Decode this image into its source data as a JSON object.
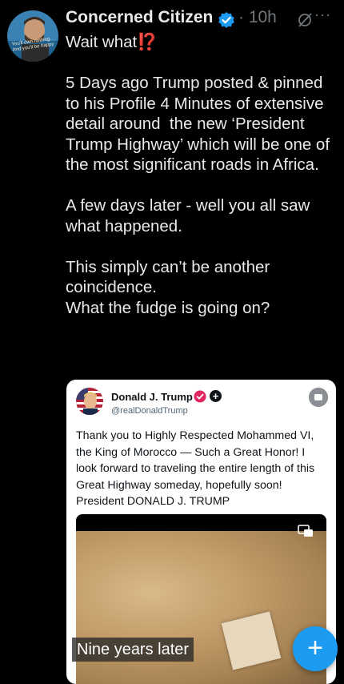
{
  "post": {
    "author": "Concerned Citizen",
    "time": "· 10h",
    "more": "···",
    "avatar_caption": "You'll own nothing. And you'll be happy",
    "text": "Wait what⁉️\n\n5 Days ago Trump posted & pinned to his Profile 4 Minutes of extensive detail around  the new ‘President Trump Highway’ which will be one of the most significant roads in Africa.\n\nA few days later - well you all saw what happened.\n\nThis simply can’t be another coincidence.\nWhat the fudge is going on?"
  },
  "quoted": {
    "name": "Donald J. Trump",
    "handle": "@realDonaldTrump",
    "plus": "+",
    "text": "Thank you to Highly Respected Mohammed VI, the King of Morocco — Such a Great Honor! I look forward to traveling the entire length of this Great Highway someday, hopefully soon! President DONALD J. TRUMP"
  },
  "media": {
    "caption": "Nine years later"
  },
  "fab": {
    "label": "+"
  },
  "colors": {
    "accent": "#1d9bf0",
    "verified": "#1d9bf0",
    "affiliate_badge": "#e0245e"
  },
  "icons": [
    "verified-badge-icon",
    "grok-icon",
    "more-icon",
    "plus-icon",
    "media-expand-icon",
    "compose-icon"
  ]
}
